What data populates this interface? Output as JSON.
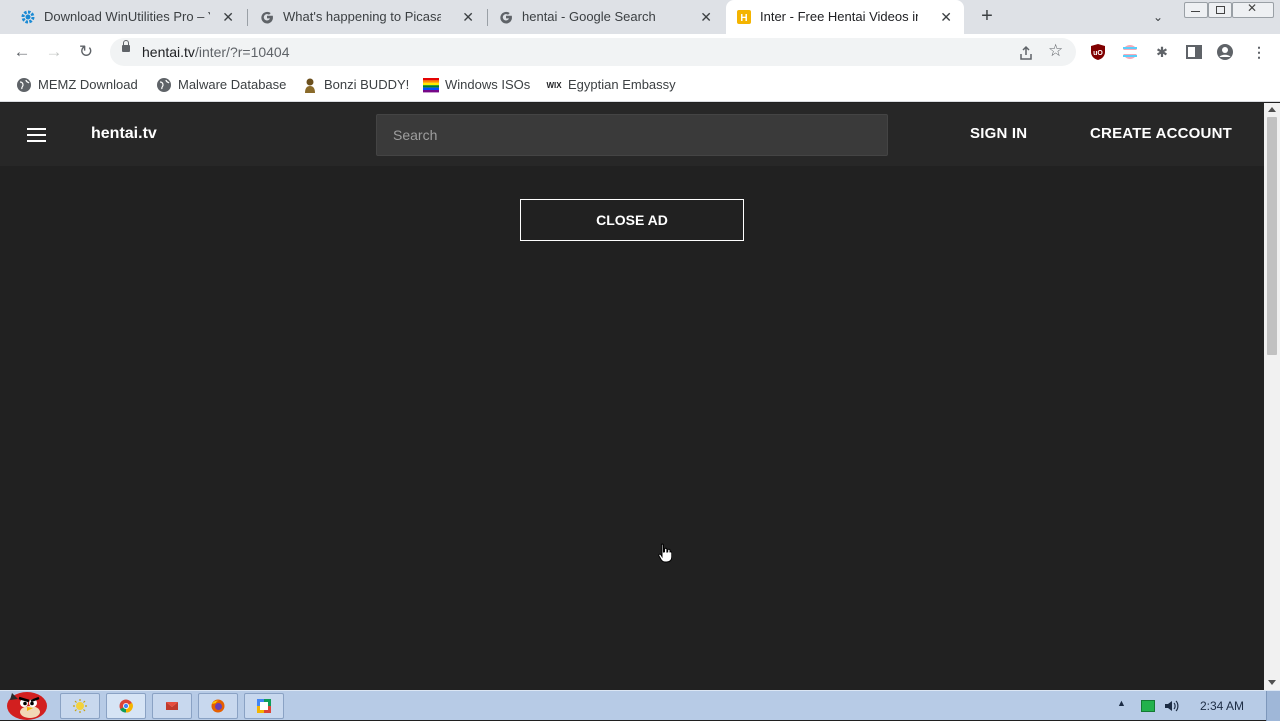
{
  "browser": {
    "tabs": [
      {
        "title": "Download WinUtilities Pro – Y",
        "icon": "gear-icon",
        "active": false
      },
      {
        "title": "What's happening to Picasa, P",
        "icon": "google-icon",
        "active": false
      },
      {
        "title": "hentai - Google Search",
        "icon": "google-icon",
        "active": false
      },
      {
        "title": "Inter - Free Hentai Videos in 7",
        "icon": "site-h-icon",
        "active": true
      }
    ],
    "new_tab_label": "+",
    "url_host": "hentai.tv",
    "url_path": "/inter/?r=10404",
    "bookmarks": [
      {
        "label": "MEMZ Download",
        "icon": "globe-icon"
      },
      {
        "label": "Malware Database",
        "icon": "globe-icon"
      },
      {
        "label": "Bonzi BUDDY!",
        "icon": "bonzi-icon"
      },
      {
        "label": "Windows ISOs",
        "icon": "rainbow-flag-icon"
      },
      {
        "label": "Egyptian Embassy",
        "icon": "wix-icon"
      }
    ]
  },
  "site": {
    "logo": "hentai.tv",
    "search_placeholder": "Search",
    "sign_in": "SIGN IN",
    "create_account": "CREATE ACCOUNT",
    "close_ad": "CLOSE AD"
  },
  "taskbar": {
    "clock": "2:34 AM",
    "apps": [
      "angry-bird-start-icon",
      "sun-icon",
      "chrome-icon",
      "mail-icon",
      "firefox-icon",
      "picasa-icon"
    ]
  },
  "colors": {
    "page_bg": "#212121",
    "header_bg": "#272727",
    "search_bg": "#3a3a3a",
    "taskbar_bg": "#b7cbe6",
    "tabstrip_bg": "#dee1e6"
  }
}
